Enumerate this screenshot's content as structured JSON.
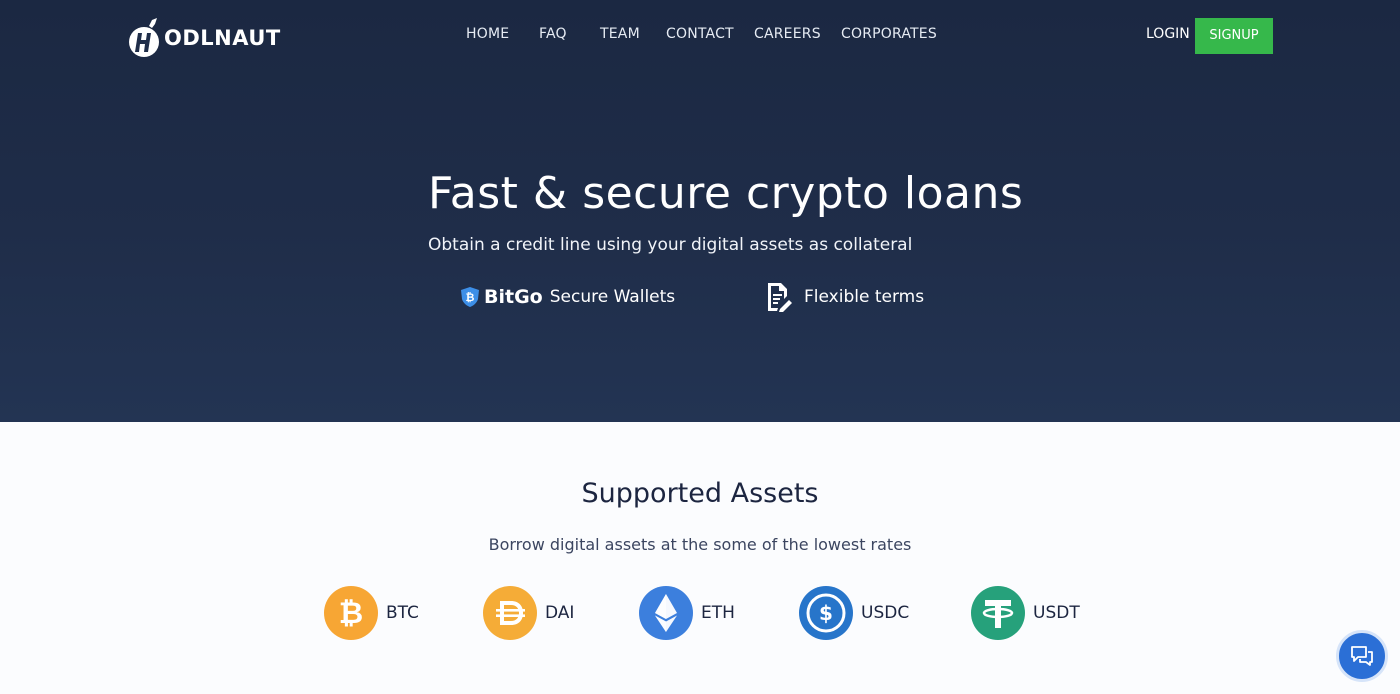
{
  "brand": {
    "name": "HODLNAUT",
    "logo_letter": "H",
    "logo_word": "ODLNAUT"
  },
  "nav": [
    {
      "label": "HOME"
    },
    {
      "label": "FAQ"
    },
    {
      "label": "TEAM"
    },
    {
      "label": "CONTACT"
    },
    {
      "label": "CAREERS"
    },
    {
      "label": "CORPORATES"
    }
  ],
  "auth": {
    "login_label": "LOGIN",
    "signup_label": "SIGNUP"
  },
  "hero": {
    "title": "Fast & secure crypto loans",
    "subtitle": "Obtain a credit line using your digital assets as collateral",
    "features": [
      {
        "brand": "BitGo",
        "label": "Secure Wallets",
        "icon": "bitgo-shield-icon"
      },
      {
        "label": "Flexible terms",
        "icon": "document-pen-icon"
      }
    ]
  },
  "assets": {
    "title": "Supported Assets",
    "subtitle": "Borrow digital assets at the some of the lowest rates",
    "items": [
      {
        "symbol": "BTC",
        "icon": "bitcoin-icon",
        "color": "#f7a634"
      },
      {
        "symbol": "DAI",
        "icon": "dai-icon",
        "color": "#f5ac37"
      },
      {
        "symbol": "ETH",
        "icon": "ethereum-icon",
        "color": "#3c7fdd"
      },
      {
        "symbol": "USDC",
        "icon": "usdc-icon",
        "color": "#2775ca"
      },
      {
        "symbol": "USDT",
        "icon": "tether-icon",
        "color": "#26a17b"
      }
    ]
  },
  "colors": {
    "hero_bg": "#1f2d49",
    "signup_bg": "#36b84b",
    "chat_bg": "#2b6fd6",
    "text_dark": "#1c2540"
  },
  "chat_widget": {
    "icon": "chat-bubbles-icon"
  }
}
